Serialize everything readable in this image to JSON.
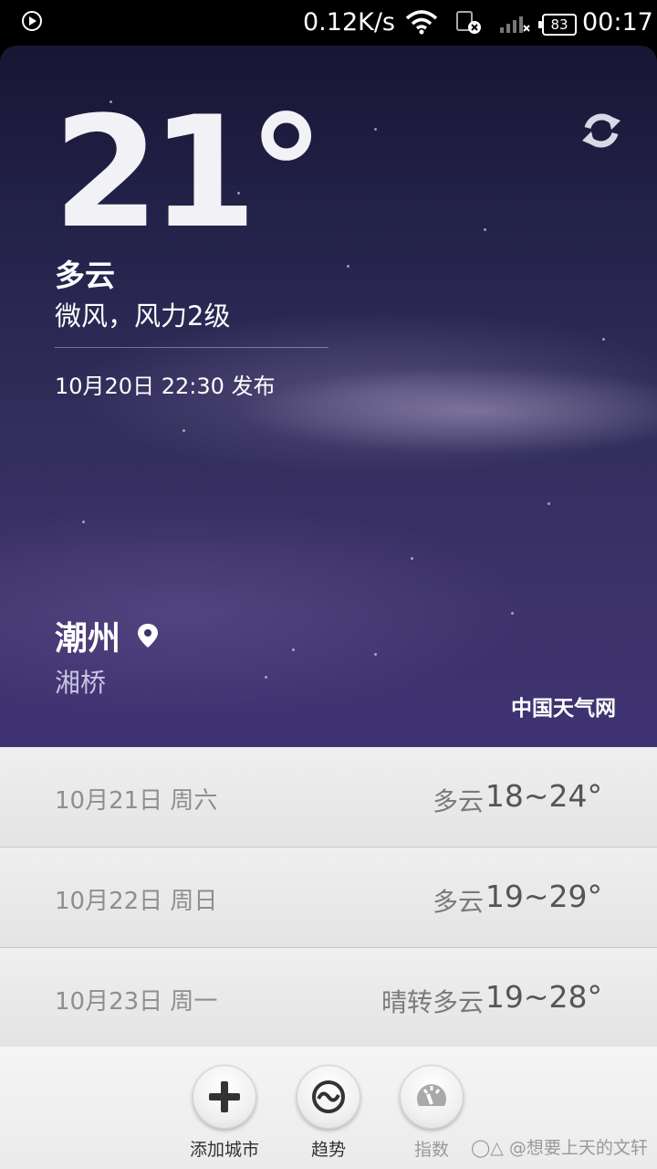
{
  "status_bar": {
    "speed": "0.12K/s",
    "battery": "83",
    "time": "00:17"
  },
  "current": {
    "temperature": "21°",
    "condition": "多云",
    "wind": "微风，风力2级",
    "published": "10月20日 22:30 发布"
  },
  "location": {
    "city": "潮州",
    "district": "湘桥"
  },
  "source": "中国天气网",
  "forecast": [
    {
      "date": "10月21日 周六",
      "condition": "多云",
      "temp": "18~24°"
    },
    {
      "date": "10月22日 周日",
      "condition": "多云",
      "temp": "19~29°"
    },
    {
      "date": "10月23日 周一",
      "condition": "晴转多云",
      "temp": "19~28°"
    }
  ],
  "bottom_bar": {
    "add_city": "添加城市",
    "trend": "趋势",
    "index": "指数"
  },
  "watermark": "◯△ @想要上天的文轩",
  "colors": {
    "hero_top": "#181634",
    "hero_bottom": "#3f3272",
    "list_bg": "#e8e8e8"
  }
}
